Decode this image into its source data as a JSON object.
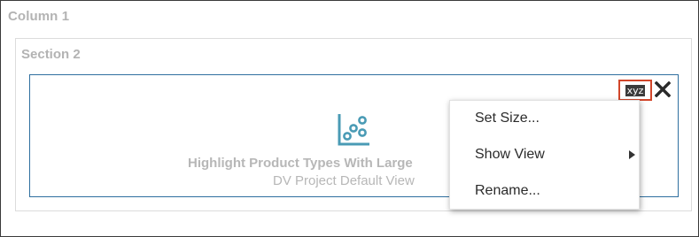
{
  "column": {
    "title": "Column 1"
  },
  "section": {
    "title": "Section 2"
  },
  "view": {
    "title": "Highlight Product Types With Large",
    "subtitle": "DV Project Default View",
    "badge_text": "xyz",
    "icon": "scatter-chart-icon",
    "accent_color": "#2f6f9f"
  },
  "toolbar": {
    "close_icon": "close-icon",
    "highlight_color": "#d2462a"
  },
  "context_menu": {
    "items": [
      {
        "label": "Set Size...",
        "has_submenu": false
      },
      {
        "label": "Show View",
        "has_submenu": true
      },
      {
        "label": "Rename...",
        "has_submenu": false
      }
    ]
  }
}
